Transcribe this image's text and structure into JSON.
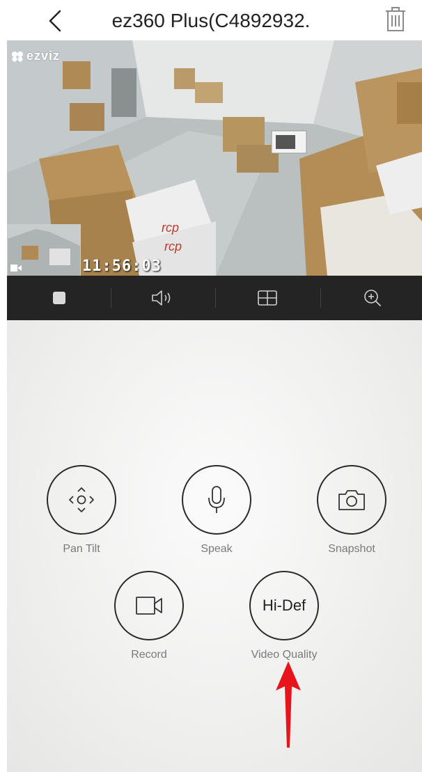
{
  "header": {
    "title": "ez360 Plus(C4892932.",
    "back_icon": "chevron-left-icon",
    "delete_icon": "trash-icon"
  },
  "video": {
    "brand_logo": "ezviz",
    "timestamp": "11:56:03",
    "record_indicator_icon": "video-camera-icon"
  },
  "control_bar": {
    "items": [
      {
        "name": "stop",
        "icon": "stop-square-icon"
      },
      {
        "name": "sound",
        "icon": "speaker-icon"
      },
      {
        "name": "layout",
        "icon": "grid-icon"
      },
      {
        "name": "zoom",
        "icon": "zoom-in-icon"
      }
    ]
  },
  "actions": {
    "pan_tilt": {
      "label": "Pan Tilt",
      "icon": "direction-pad-icon"
    },
    "speak": {
      "label": "Speak",
      "icon": "microphone-icon"
    },
    "snapshot": {
      "label": "Snapshot",
      "icon": "camera-icon"
    },
    "record": {
      "label": "Record",
      "icon": "video-camera-icon"
    },
    "video_quality": {
      "label": "Video Quality",
      "value": "Hi-Def"
    }
  },
  "colors": {
    "control_bar_bg": "#242424",
    "circle_border": "#2a2a2a",
    "label_gray": "#7a7a7a",
    "annotation_arrow": "#e8141b"
  }
}
